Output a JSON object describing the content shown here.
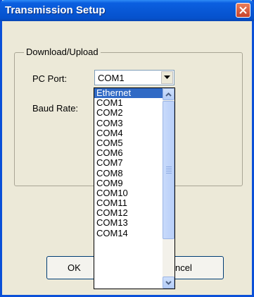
{
  "dialog": {
    "title": "Transmission Setup",
    "group_label": "Download/Upload",
    "pc_port_label": "PC Port:",
    "baud_rate_label": "Baud Rate:",
    "ok_label": "OK",
    "cancel_label": "ncel"
  },
  "port_select": {
    "selected_value": "COM1",
    "options": [
      "Ethernet",
      "COM1",
      "COM2",
      "COM3",
      "COM4",
      "COM5",
      "COM6",
      "COM7",
      "COM8",
      "COM9",
      "COM10",
      "COM11",
      "COM12",
      "COM13",
      "COM14"
    ],
    "highlighted_option": "Ethernet"
  },
  "colors": {
    "titlebar": "#0858d6",
    "selection": "#316ac5",
    "close_button": "#d6553a"
  },
  "icons": [
    "close-icon",
    "chevron-down-icon",
    "scroll-up-icon",
    "scroll-down-icon"
  ]
}
